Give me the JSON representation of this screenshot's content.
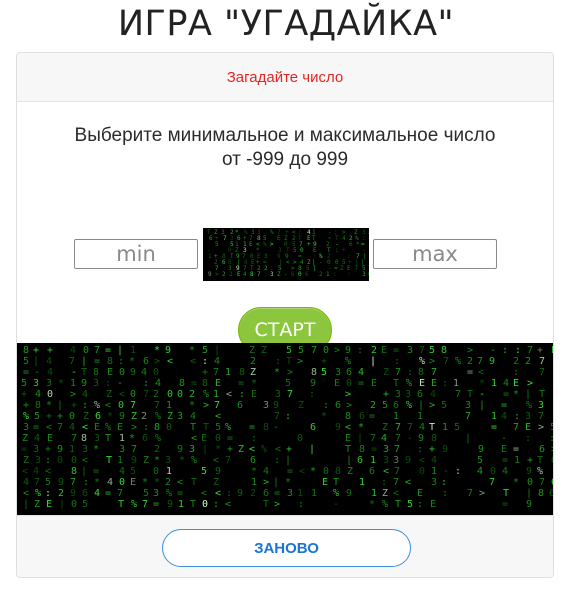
{
  "page": {
    "title": "ИГРА \"УГАДАЙКА\""
  },
  "card": {
    "header_text": "Загадайте число",
    "instruction_line1": "Выберите минимальное и максимальное число",
    "instruction_line2": "от -999 до 999"
  },
  "inputs": {
    "min_placeholder": "min",
    "max_placeholder": "max",
    "min_value": "",
    "max_value": ""
  },
  "buttons": {
    "start_label": "СТАРТ",
    "restart_label": "ЗАНОВО"
  },
  "colors": {
    "header_text": "#e32622",
    "start_button": "#8cc63f",
    "restart_border": "#3a8fe3",
    "matrix_green": "#2cf02c"
  },
  "images": {
    "thumb": "matrix-digital-rain",
    "banner": "matrix-digital-rain"
  }
}
